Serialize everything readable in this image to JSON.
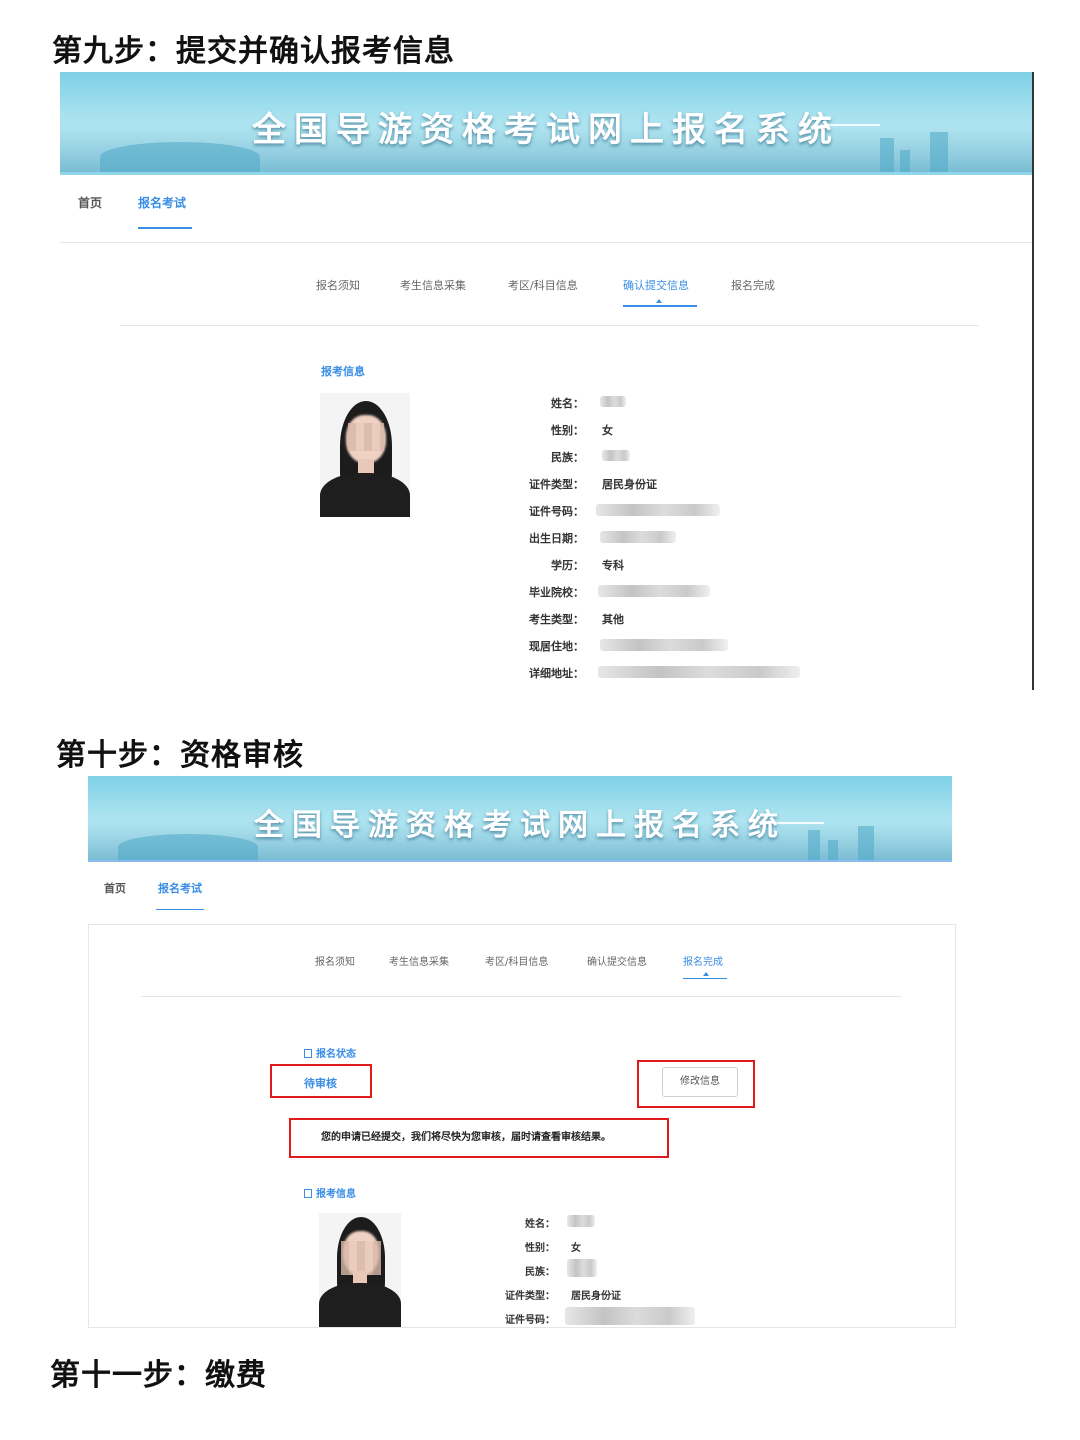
{
  "step9": {
    "title": "第九步：提交并确认报考信息",
    "banner_title": "全国导游资格考试网上报名系统",
    "nav": [
      "首页",
      "报名考试"
    ],
    "steps": [
      "报名须知",
      "考生信息采集",
      "考区/科目信息",
      "确认提交信息",
      "报名完成"
    ],
    "active_step": 3,
    "section_title": "报考信息",
    "fields": [
      {
        "label": "姓名：",
        "value": ""
      },
      {
        "label": "性别：",
        "value": "女"
      },
      {
        "label": "民族：",
        "value": ""
      },
      {
        "label": "证件类型：",
        "value": "居民身份证"
      },
      {
        "label": "证件号码：",
        "value": ""
      },
      {
        "label": "出生日期：",
        "value": ""
      },
      {
        "label": "学历：",
        "value": "专科"
      },
      {
        "label": "毕业院校：",
        "value": ""
      },
      {
        "label": "考生类型：",
        "value": "其他"
      },
      {
        "label": "现居住地：",
        "value": ""
      },
      {
        "label": "详细地址：",
        "value": ""
      }
    ]
  },
  "step10": {
    "title": "第十步：资格审核",
    "banner_title": "全国导游资格考试网上报名系统",
    "nav": [
      "首页",
      "报名考试"
    ],
    "steps": [
      "报名须知",
      "考生信息采集",
      "考区/科目信息",
      "确认提交信息",
      "报名完成"
    ],
    "active_step": 4,
    "status_section": "报名状态",
    "status_value": "待审核",
    "modify_button": "修改信息",
    "message": "您的申请已经提交，我们将尽快为您审核，届时请查看审核结果。",
    "section_title": "报考信息",
    "fields": [
      {
        "label": "姓名：",
        "value": ""
      },
      {
        "label": "性别：",
        "value": "女"
      },
      {
        "label": "民族：",
        "value": ""
      },
      {
        "label": "证件类型：",
        "value": "居民身份证"
      },
      {
        "label": "证件号码：",
        "value": ""
      }
    ]
  },
  "step11": {
    "title": "第十一步：缴费"
  },
  "colors": {
    "accent": "#3a8ee6",
    "highlight_box": "#e11b1b",
    "banner": "#7fd0e6"
  }
}
